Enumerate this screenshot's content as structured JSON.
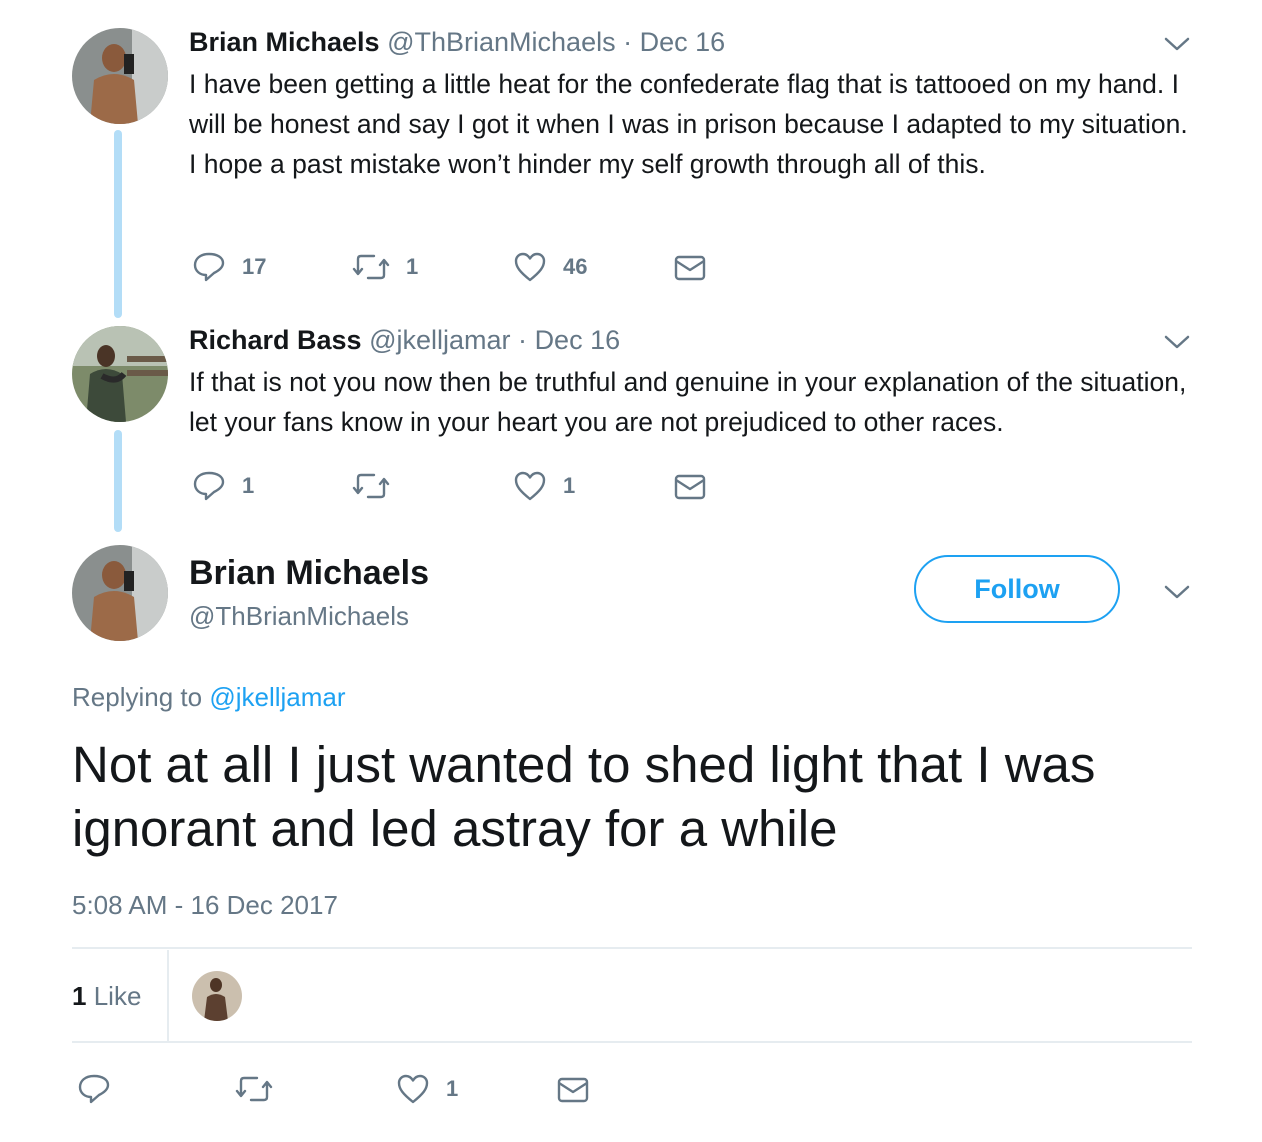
{
  "thread": [
    {
      "display_name": "Brian Michaels",
      "handle": "@ThBrianMichaels",
      "date": "Dec 16",
      "text": "I have been getting a little heat for the confederate flag that is tattooed on my hand. I will be honest and say I got it when I was in prison because I adapted to my situation. I hope a past mistake won’t hinder my self growth through all of this.",
      "reply_count": "17",
      "retweet_count": "1",
      "like_count": "46"
    },
    {
      "display_name": "Richard Bass",
      "handle": "@jkelljamar",
      "date": "Dec 16",
      "text": "If that is not you now then be truthful and genuine in your explanation of the situation, let your fans know in your heart you are not prejudiced to other races.",
      "reply_count": "1",
      "retweet_count": "",
      "like_count": "1"
    }
  ],
  "main_tweet": {
    "display_name": "Brian Michaels",
    "handle": "@ThBrianMichaels",
    "follow_label": "Follow",
    "replying_prefix": "Replying to",
    "replying_to": "@jkelljamar",
    "text": "Not at all I just wanted to shed light that I was ignorant and led astray for a while",
    "timestamp": "5:08 AM - 16 Dec 2017",
    "likes_count": "1",
    "likes_label": "Like",
    "reply_count": "",
    "retweet_count": "",
    "like_count": "1"
  },
  "colors": {
    "accent": "#1da1f2",
    "muted": "#657786",
    "thread_line": "#b3ddf7",
    "divider": "#e6ecf0"
  }
}
